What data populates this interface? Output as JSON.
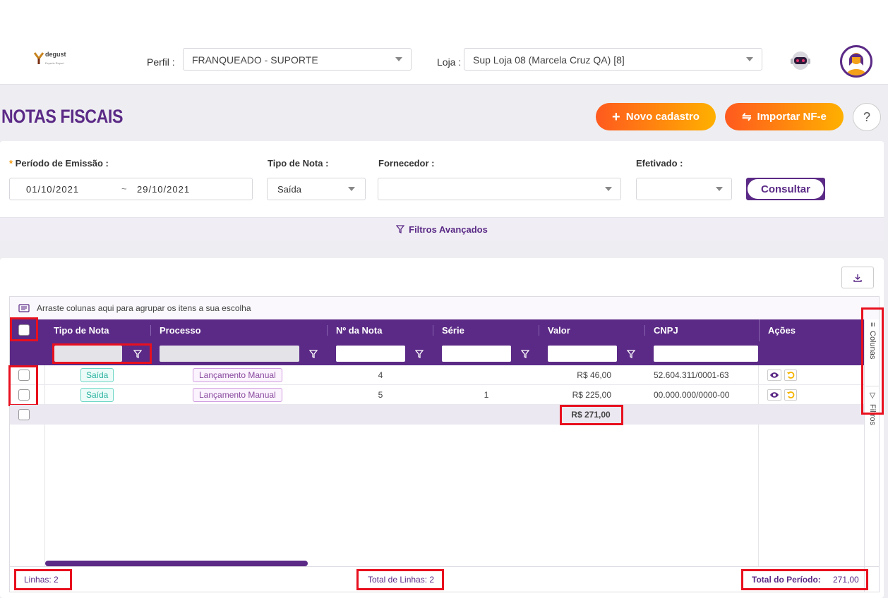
{
  "brand": {
    "logo_word": "degust",
    "logo_sub": "Experts Report"
  },
  "header": {
    "perfil_label": "Perfil :",
    "perfil_value": "FRANQUEADO - SUPORTE",
    "loja_label": "Loja :",
    "loja_value": "Sup Loja 08 (Marcela Cruz QA) [8]"
  },
  "page": {
    "title": "NOTAS FISCAIS",
    "new_button": "Novo cadastro",
    "import_button": "Importar NF-e",
    "help": "?"
  },
  "filters": {
    "periodo_label": "Período de Emissão :",
    "date_from": "01/10/2021",
    "date_sep": "~",
    "date_to": "29/10/2021",
    "tipo_label": "Tipo de Nota :",
    "tipo_value": "Saída",
    "fornecedor_label": "Fornecedor :",
    "fornecedor_value": "",
    "efetivado_label": "Efetivado :",
    "efetivado_value": "",
    "consultar": "Consultar",
    "advanced": "Filtros Avançados"
  },
  "grid": {
    "group_hint": "Arraste colunas aqui para agrupar os itens a sua escolha",
    "columns": [
      "Tipo de Nota",
      "Processo",
      "Nº da Nota",
      "Série",
      "Valor",
      "CNPJ",
      "Ações"
    ],
    "rows": [
      {
        "tipo": "Saída",
        "processo": "Lançamento Manual",
        "numero": "4",
        "serie": "",
        "valor": "R$ 46,00",
        "cnpj": "52.604.311/0001-63"
      },
      {
        "tipo": "Saída",
        "processo": "Lançamento Manual",
        "numero": "5",
        "serie": "1",
        "valor": "R$ 225,00",
        "cnpj": "00.000.000/0000-00"
      }
    ],
    "total_valor": "R$ 271,00",
    "side_colunas": "Colunas",
    "side_filtros": "Filtros",
    "footer_linhas": "Linhas: 2",
    "footer_total_linhas": "Total de Linhas: 2",
    "footer_total_periodo_label": "Total do Período:",
    "footer_total_periodo_value": "271,00"
  },
  "colors": {
    "primary": "#5b2a86",
    "accent_start": "#ff5a1e",
    "accent_end": "#ffb000",
    "highlight": "#e8101e"
  }
}
